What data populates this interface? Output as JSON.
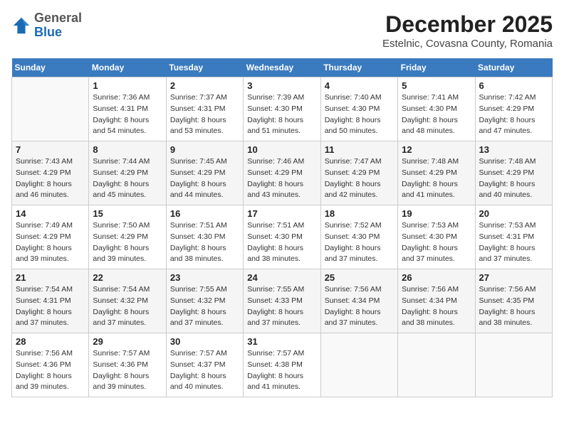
{
  "header": {
    "logo_general": "General",
    "logo_blue": "Blue",
    "title": "December 2025",
    "subtitle": "Estelnic, Covasna County, Romania"
  },
  "days_of_week": [
    "Sunday",
    "Monday",
    "Tuesday",
    "Wednesday",
    "Thursday",
    "Friday",
    "Saturday"
  ],
  "weeks": [
    [
      {
        "day": "",
        "sunrise": "",
        "sunset": "",
        "daylight": ""
      },
      {
        "day": "1",
        "sunrise": "Sunrise: 7:36 AM",
        "sunset": "Sunset: 4:31 PM",
        "daylight": "Daylight: 8 hours and 54 minutes."
      },
      {
        "day": "2",
        "sunrise": "Sunrise: 7:37 AM",
        "sunset": "Sunset: 4:31 PM",
        "daylight": "Daylight: 8 hours and 53 minutes."
      },
      {
        "day": "3",
        "sunrise": "Sunrise: 7:39 AM",
        "sunset": "Sunset: 4:30 PM",
        "daylight": "Daylight: 8 hours and 51 minutes."
      },
      {
        "day": "4",
        "sunrise": "Sunrise: 7:40 AM",
        "sunset": "Sunset: 4:30 PM",
        "daylight": "Daylight: 8 hours and 50 minutes."
      },
      {
        "day": "5",
        "sunrise": "Sunrise: 7:41 AM",
        "sunset": "Sunset: 4:30 PM",
        "daylight": "Daylight: 8 hours and 48 minutes."
      },
      {
        "day": "6",
        "sunrise": "Sunrise: 7:42 AM",
        "sunset": "Sunset: 4:29 PM",
        "daylight": "Daylight: 8 hours and 47 minutes."
      }
    ],
    [
      {
        "day": "7",
        "sunrise": "Sunrise: 7:43 AM",
        "sunset": "Sunset: 4:29 PM",
        "daylight": "Daylight: 8 hours and 46 minutes."
      },
      {
        "day": "8",
        "sunrise": "Sunrise: 7:44 AM",
        "sunset": "Sunset: 4:29 PM",
        "daylight": "Daylight: 8 hours and 45 minutes."
      },
      {
        "day": "9",
        "sunrise": "Sunrise: 7:45 AM",
        "sunset": "Sunset: 4:29 PM",
        "daylight": "Daylight: 8 hours and 44 minutes."
      },
      {
        "day": "10",
        "sunrise": "Sunrise: 7:46 AM",
        "sunset": "Sunset: 4:29 PM",
        "daylight": "Daylight: 8 hours and 43 minutes."
      },
      {
        "day": "11",
        "sunrise": "Sunrise: 7:47 AM",
        "sunset": "Sunset: 4:29 PM",
        "daylight": "Daylight: 8 hours and 42 minutes."
      },
      {
        "day": "12",
        "sunrise": "Sunrise: 7:48 AM",
        "sunset": "Sunset: 4:29 PM",
        "daylight": "Daylight: 8 hours and 41 minutes."
      },
      {
        "day": "13",
        "sunrise": "Sunrise: 7:48 AM",
        "sunset": "Sunset: 4:29 PM",
        "daylight": "Daylight: 8 hours and 40 minutes."
      }
    ],
    [
      {
        "day": "14",
        "sunrise": "Sunrise: 7:49 AM",
        "sunset": "Sunset: 4:29 PM",
        "daylight": "Daylight: 8 hours and 39 minutes."
      },
      {
        "day": "15",
        "sunrise": "Sunrise: 7:50 AM",
        "sunset": "Sunset: 4:29 PM",
        "daylight": "Daylight: 8 hours and 39 minutes."
      },
      {
        "day": "16",
        "sunrise": "Sunrise: 7:51 AM",
        "sunset": "Sunset: 4:30 PM",
        "daylight": "Daylight: 8 hours and 38 minutes."
      },
      {
        "day": "17",
        "sunrise": "Sunrise: 7:51 AM",
        "sunset": "Sunset: 4:30 PM",
        "daylight": "Daylight: 8 hours and 38 minutes."
      },
      {
        "day": "18",
        "sunrise": "Sunrise: 7:52 AM",
        "sunset": "Sunset: 4:30 PM",
        "daylight": "Daylight: 8 hours and 37 minutes."
      },
      {
        "day": "19",
        "sunrise": "Sunrise: 7:53 AM",
        "sunset": "Sunset: 4:30 PM",
        "daylight": "Daylight: 8 hours and 37 minutes."
      },
      {
        "day": "20",
        "sunrise": "Sunrise: 7:53 AM",
        "sunset": "Sunset: 4:31 PM",
        "daylight": "Daylight: 8 hours and 37 minutes."
      }
    ],
    [
      {
        "day": "21",
        "sunrise": "Sunrise: 7:54 AM",
        "sunset": "Sunset: 4:31 PM",
        "daylight": "Daylight: 8 hours and 37 minutes."
      },
      {
        "day": "22",
        "sunrise": "Sunrise: 7:54 AM",
        "sunset": "Sunset: 4:32 PM",
        "daylight": "Daylight: 8 hours and 37 minutes."
      },
      {
        "day": "23",
        "sunrise": "Sunrise: 7:55 AM",
        "sunset": "Sunset: 4:32 PM",
        "daylight": "Daylight: 8 hours and 37 minutes."
      },
      {
        "day": "24",
        "sunrise": "Sunrise: 7:55 AM",
        "sunset": "Sunset: 4:33 PM",
        "daylight": "Daylight: 8 hours and 37 minutes."
      },
      {
        "day": "25",
        "sunrise": "Sunrise: 7:56 AM",
        "sunset": "Sunset: 4:34 PM",
        "daylight": "Daylight: 8 hours and 37 minutes."
      },
      {
        "day": "26",
        "sunrise": "Sunrise: 7:56 AM",
        "sunset": "Sunset: 4:34 PM",
        "daylight": "Daylight: 8 hours and 38 minutes."
      },
      {
        "day": "27",
        "sunrise": "Sunrise: 7:56 AM",
        "sunset": "Sunset: 4:35 PM",
        "daylight": "Daylight: 8 hours and 38 minutes."
      }
    ],
    [
      {
        "day": "28",
        "sunrise": "Sunrise: 7:56 AM",
        "sunset": "Sunset: 4:36 PM",
        "daylight": "Daylight: 8 hours and 39 minutes."
      },
      {
        "day": "29",
        "sunrise": "Sunrise: 7:57 AM",
        "sunset": "Sunset: 4:36 PM",
        "daylight": "Daylight: 8 hours and 39 minutes."
      },
      {
        "day": "30",
        "sunrise": "Sunrise: 7:57 AM",
        "sunset": "Sunset: 4:37 PM",
        "daylight": "Daylight: 8 hours and 40 minutes."
      },
      {
        "day": "31",
        "sunrise": "Sunrise: 7:57 AM",
        "sunset": "Sunset: 4:38 PM",
        "daylight": "Daylight: 8 hours and 41 minutes."
      },
      {
        "day": "",
        "sunrise": "",
        "sunset": "",
        "daylight": ""
      },
      {
        "day": "",
        "sunrise": "",
        "sunset": "",
        "daylight": ""
      },
      {
        "day": "",
        "sunrise": "",
        "sunset": "",
        "daylight": ""
      }
    ]
  ]
}
